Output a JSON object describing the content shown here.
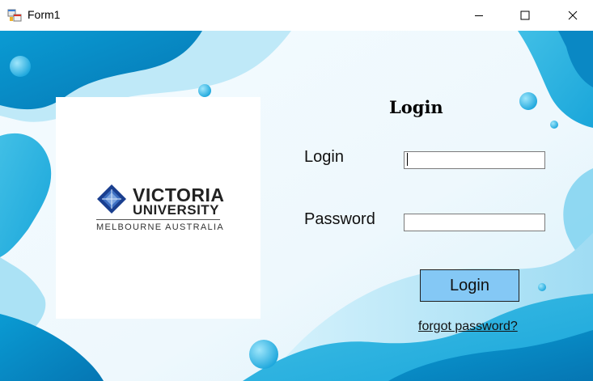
{
  "window": {
    "title": "Form1",
    "icon": "winforms-app-icon",
    "controls": [
      "minimize-icon",
      "maximize-icon",
      "close-icon"
    ]
  },
  "logo": {
    "line1": "VICTORIA",
    "line2": "UNIVERSITY",
    "line3": "MELBOURNE AUSTRALIA"
  },
  "form": {
    "heading": "Login",
    "login_label": "Login",
    "login_value": "",
    "password_label": "Password",
    "password_value": "",
    "submit_label": "Login",
    "forgot_label": "forgot password?"
  },
  "colors": {
    "button_fill": "#84c8f5",
    "wave_dark": "#0596cf",
    "wave_light": "#8fdaf2"
  }
}
